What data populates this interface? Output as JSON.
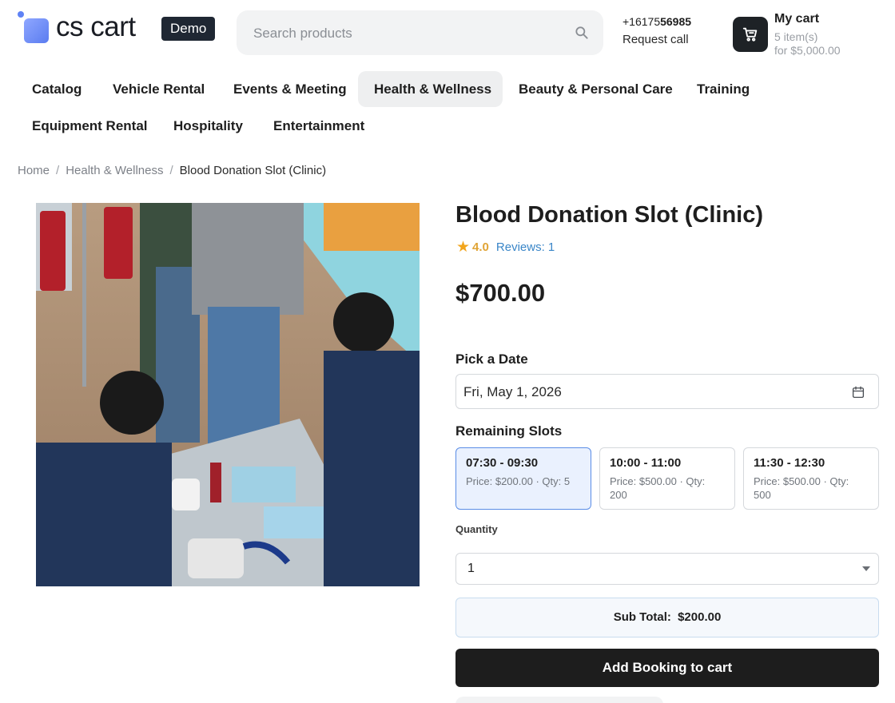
{
  "header": {
    "logo_text": "cs cart",
    "demo_badge": "Demo",
    "search_placeholder": "Search products",
    "phone_prefix": "+16175",
    "phone_bold": "56985",
    "request_call": "Request call",
    "cart": {
      "title": "My cart",
      "items": "5 item(s)",
      "total": "for $5,000.00"
    }
  },
  "nav": {
    "items": [
      {
        "label": "Catalog"
      },
      {
        "label": "Vehicle Rental"
      },
      {
        "label": "Events & Meeting"
      },
      {
        "label": "Health & Wellness",
        "active": true
      },
      {
        "label": "Beauty & Personal Care"
      },
      {
        "label": "Training"
      },
      {
        "label": "Equipment Rental"
      },
      {
        "label": "Hospitality"
      },
      {
        "label": "Entertainment"
      }
    ]
  },
  "breadcrumb": {
    "home": "Home",
    "category": "Health & Wellness",
    "current": "Blood Donation Slot (Clinic)",
    "separator": "/"
  },
  "product": {
    "title": "Blood Donation Slot (Clinic)",
    "rating": "4.0",
    "reviews": "Reviews: 1",
    "price": "$700.00",
    "pick_date_label": "Pick a Date",
    "date_value": "Fri, May 1, 2026",
    "remaining_slots_label": "Remaining Slots",
    "slots": [
      {
        "time": "07:30 - 09:30",
        "meta": "Price: $200.00 · Qty: 5",
        "selected": true
      },
      {
        "time": "10:00 - 11:00",
        "meta": "Price: $500.00 · Qty: 200",
        "selected": false
      },
      {
        "time": "11:30 - 12:30",
        "meta": "Price: $500.00 · Qty: 500",
        "selected": false
      }
    ],
    "quantity_label": "Quantity",
    "quantity_value": "1",
    "subtotal_label": "Sub Total:",
    "subtotal_value": "$200.00",
    "add_button": "Add Booking to cart"
  },
  "colors": {
    "accent_blue": "#5a8de6",
    "selected_slot_bg": "#eaf1fe",
    "star": "#f2a51c",
    "link": "#3a86c8",
    "button_bg": "#1d1d1d"
  },
  "icons": {
    "search": "search-icon",
    "cart": "cart-icon",
    "calendar": "calendar-icon",
    "star": "star-icon",
    "caret": "chevron-down-icon"
  }
}
